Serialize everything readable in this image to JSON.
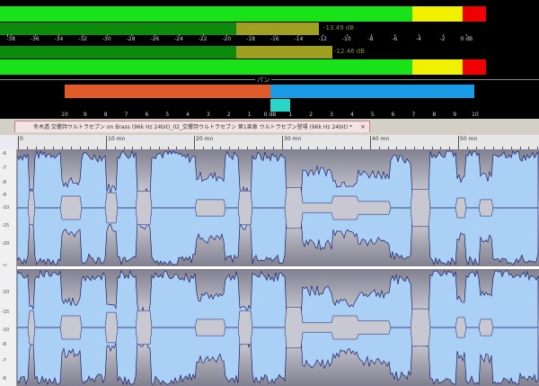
{
  "meters": {
    "left_peak": "-13.49 dB",
    "right_peak": "-12.46 dB",
    "db_ticks": [
      "-38",
      "-36",
      "-34",
      "-32",
      "-30",
      "-28",
      "-26",
      "-24",
      "-22",
      "-20",
      "-18",
      "-16",
      "-14",
      "-12",
      "-10",
      "-8",
      "-6",
      "-4",
      "-2",
      "0 dB"
    ]
  },
  "pan": {
    "label": "パン",
    "ticks": [
      "10",
      "9",
      "8",
      "7",
      "6",
      "5",
      "4",
      "3",
      "2",
      "1",
      "0 dB",
      "1",
      "2",
      "3",
      "4",
      "5",
      "6",
      "7",
      "8",
      "9",
      "10"
    ]
  },
  "document": {
    "tab_title": "冬木透 交響詩ウルトラセブン on Brass (96k Hz 24bit)_02_交響詩ウルトラセブン 第1楽章 ウルトラセブン登場 (96k Hz 24bit) *",
    "close_glyph": "×"
  },
  "ruler": {
    "marks": [
      "0",
      "10 mn",
      "20 mn",
      "30 mn",
      "40 mn",
      "50 mn"
    ]
  },
  "amplitude_axis": {
    "ticks": [
      "-6",
      "-7",
      "-8",
      "-9",
      "-10",
      "-15",
      "-20",
      "-∞",
      "-20",
      "-15",
      "-10",
      "-8",
      "-7",
      "-6"
    ]
  },
  "colors": {
    "meter_green": "#19e219",
    "meter_dark_green": "#0b8a0b",
    "meter_olive": "#a0a020",
    "meter_yellow": "#f0f000",
    "meter_red": "#ee0000",
    "pan_left": "#e05a2a",
    "pan_right": "#1a9be6",
    "wave_fill": "#aad0f5",
    "wave_stroke": "#1d1d6a"
  }
}
